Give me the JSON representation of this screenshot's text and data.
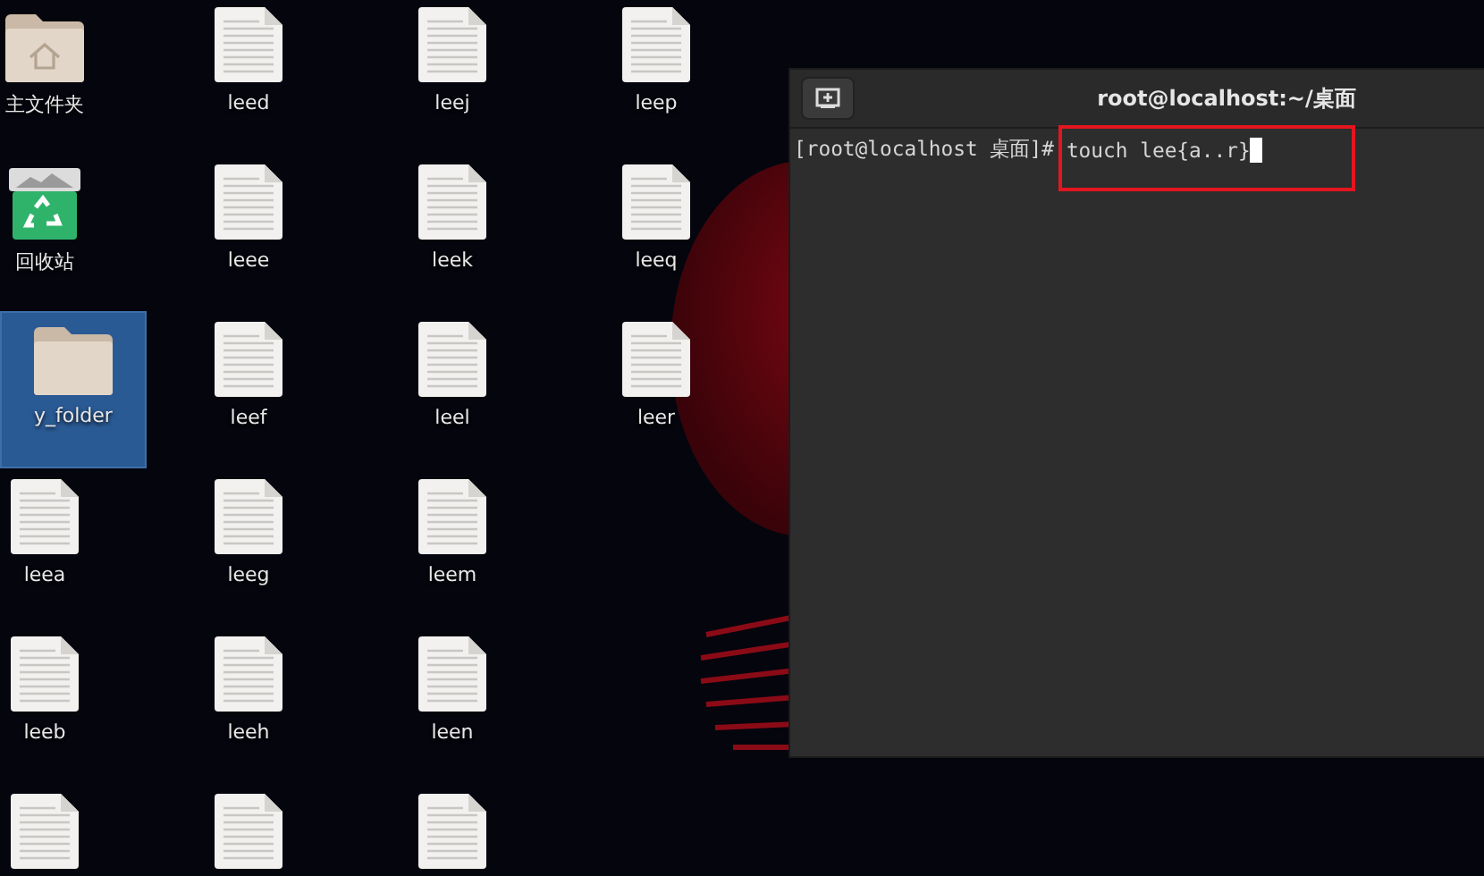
{
  "desktop": {
    "columns": [
      [
        {
          "kind": "home-folder",
          "label": "主文件夹",
          "selected": false
        },
        {
          "kind": "trash",
          "label": "回收站",
          "selected": false
        },
        {
          "kind": "folder",
          "label": "y_folder",
          "selected": true
        },
        {
          "kind": "file",
          "label": "leea",
          "selected": false
        },
        {
          "kind": "file",
          "label": "leeb",
          "selected": false
        },
        {
          "kind": "file",
          "selected": false
        }
      ],
      [
        {
          "kind": "file",
          "label": "leed",
          "selected": false
        },
        {
          "kind": "file",
          "label": "leee",
          "selected": false
        },
        {
          "kind": "file",
          "label": "leef",
          "selected": false
        },
        {
          "kind": "file",
          "label": "leeg",
          "selected": false
        },
        {
          "kind": "file",
          "label": "leeh",
          "selected": false
        },
        {
          "kind": "file",
          "selected": false
        }
      ],
      [
        {
          "kind": "file",
          "label": "leej",
          "selected": false
        },
        {
          "kind": "file",
          "label": "leek",
          "selected": false
        },
        {
          "kind": "file",
          "label": "leel",
          "selected": false
        },
        {
          "kind": "file",
          "label": "leem",
          "selected": false
        },
        {
          "kind": "file",
          "label": "leen",
          "selected": false
        },
        {
          "kind": "file",
          "selected": false
        }
      ],
      [
        {
          "kind": "file",
          "label": "leep",
          "selected": false
        },
        {
          "kind": "file",
          "label": "leeq",
          "selected": false
        },
        {
          "kind": "file",
          "label": "leer",
          "selected": false
        }
      ]
    ]
  },
  "terminal": {
    "title": "root@localhost:~/桌面",
    "lines": [
      {
        "prompt": "[root@localhost 桌面]#",
        "command": "touch lee{a..r}"
      }
    ]
  }
}
